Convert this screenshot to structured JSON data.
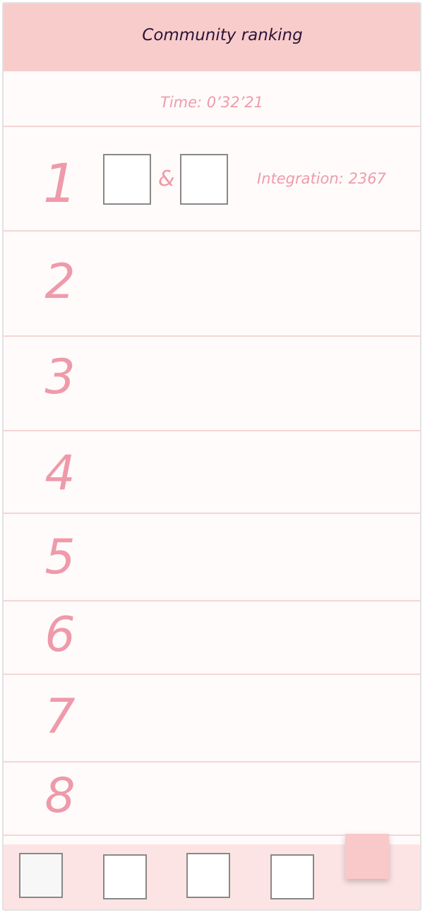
{
  "header": {
    "title": "Community ranking"
  },
  "timer": {
    "label": "Time: 0’32’21"
  },
  "ranking": {
    "rows": [
      {
        "rank": "1",
        "connector": "&",
        "score_label": "Integration: 2367"
      },
      {
        "rank": "2"
      },
      {
        "rank": "3"
      },
      {
        "rank": "4"
      },
      {
        "rank": "5"
      },
      {
        "rank": "6"
      },
      {
        "rank": "7"
      },
      {
        "rank": "8"
      }
    ]
  },
  "tabbar": {
    "tabs": [
      "tab-1",
      "tab-2",
      "tab-3",
      "tab-4"
    ]
  },
  "colors": {
    "header_bg": "#f9cccc",
    "accent_pink": "#ee9aaa",
    "tabbar_bg": "#fde4e4",
    "fab_bg": "#f9c8c8"
  }
}
